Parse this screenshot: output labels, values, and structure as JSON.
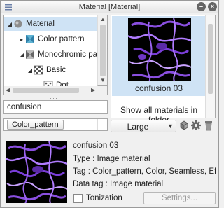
{
  "window": {
    "title": "Material [Material]"
  },
  "tree": {
    "items": [
      {
        "label": "Material",
        "icon": "material-ball-icon",
        "expanded": true,
        "selected": true
      },
      {
        "label": "Color pattern",
        "icon": "color-pattern-icon",
        "expanded": false
      },
      {
        "label": "Monochromic pat",
        "icon": "monochromic-pattern-icon",
        "expanded": true
      },
      {
        "label": "Basic",
        "icon": "basic-pattern-icon",
        "expanded": true
      },
      {
        "label": "Dot",
        "icon": "dot-pattern-icon",
        "expanded": false
      }
    ]
  },
  "search": {
    "value": "confusion"
  },
  "tags": {
    "active": "Color_pattern"
  },
  "material": {
    "name": "confusion 03",
    "show_all_label": "Show all materials in folder"
  },
  "view": {
    "size": "Large"
  },
  "detail": {
    "name": "confusion 03",
    "type_line": "Type : Image material",
    "tag_line": "Tag : Color_pattern, Color, Seamless, Effe",
    "datatag_line": "Data tag : Image material",
    "tonization_label": "Tonization",
    "settings_label": "Settings..."
  },
  "colors": {
    "selection": "#cfe3f5",
    "pattern_dark": "#000000",
    "pattern_purple": "#8a4fe0"
  }
}
